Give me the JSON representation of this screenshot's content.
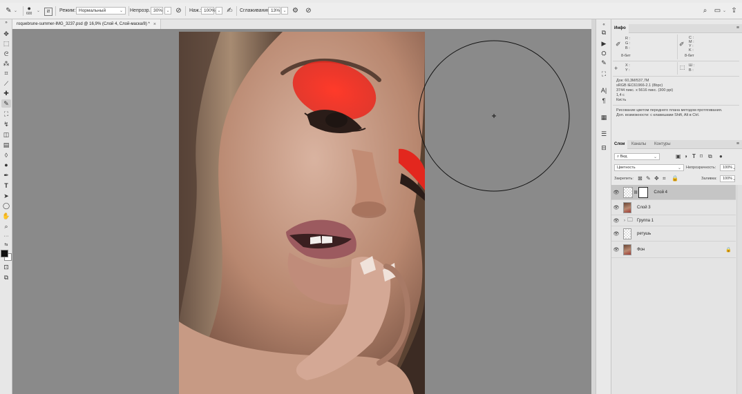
{
  "options_bar": {
    "brush_size": "600",
    "mode_label": "Режим:",
    "mode_value": "Нормальный",
    "opacity_label": "Непрозр.:",
    "opacity_value": "30%",
    "flow_label": "Наж.:",
    "flow_value": "100%",
    "smoothing_label": "Сглаживание:",
    "smoothing_value": "13%"
  },
  "document": {
    "tab_title": "roquebrune-summer-IMG_3237.psd @ 16,9% (Слой 4, Слой-маска/8) *"
  },
  "info_panel": {
    "title": "Инфо",
    "r": "R :",
    "g": "G :",
    "b": "B :",
    "c": "C :",
    "m": "M :",
    "y": "Y :",
    "k": "K :",
    "bit_left": "8-бит",
    "bit_right": "8-бит",
    "x": "X :",
    "y_coord": "Y :",
    "w": "Ш :",
    "h": "В :",
    "doc_size": "Док: 60,3M/537,7M",
    "color_profile": "sRGB IEC61966-2.1 (8bpc)",
    "dimensions": "3744 пикс. x 5616 пикс. (300 ppi)",
    "time": "1,4 с",
    "tool": "Кисть",
    "hint1": "Рисование цветом переднего плана методом протягивания.",
    "hint2": "Доп. возможности: с клавишами Shift, Alt в Ctrl."
  },
  "layers_panel": {
    "tabs": [
      "Слои",
      "Каналы",
      "Контуры"
    ],
    "filter_value": "Вид",
    "blend_mode": "Цветность",
    "opacity_label": "Непрозрачность:",
    "opacity_value": "100%",
    "lock_label": "Закрепить:",
    "fill_label": "Заливка:",
    "fill_value": "100%",
    "layers": [
      {
        "name": "Слой 4"
      },
      {
        "name": "Слой 3"
      },
      {
        "name": "Группа 1"
      },
      {
        "name": "ретушь"
      },
      {
        "name": "Фон"
      }
    ]
  },
  "colors": {
    "canvas_bg": "#8a8a8a",
    "selected_layer": "#c5c5c5",
    "eyeshadow": "#e3271e"
  }
}
